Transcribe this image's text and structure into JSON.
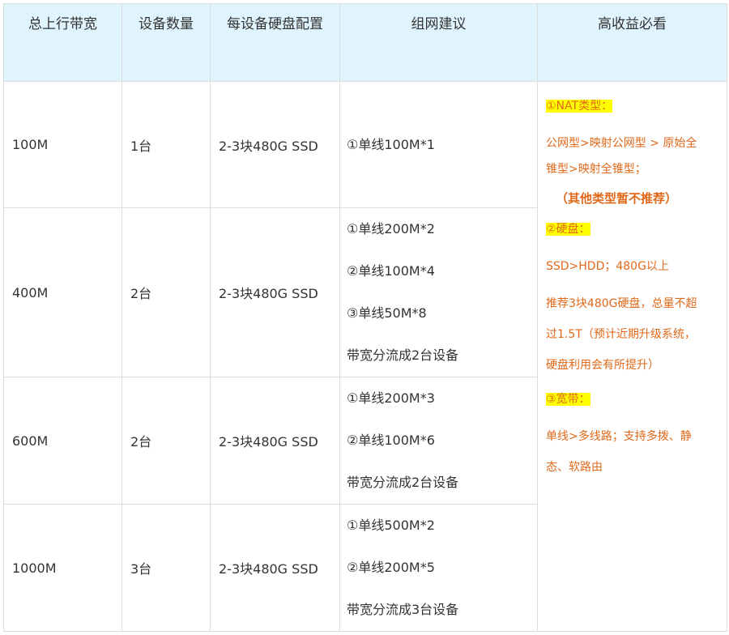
{
  "headers": [
    "总上行带宽",
    "设备数量",
    "每设备硬盘配置",
    "组网建议",
    "高收益必看"
  ],
  "rows": [
    {
      "bandwidth": "100M",
      "devices": "1台",
      "disk": "2-3块480G  SSD",
      "advice": [
        "①单线100M*1"
      ]
    },
    {
      "bandwidth": "400M",
      "devices": "2台",
      "disk": "2-3块480G  SSD",
      "advice": [
        "①单线200M*2",
        "②单线100M*4",
        "③单线50M*8",
        "带宽分流成2台设备"
      ]
    },
    {
      "bandwidth": "600M",
      "devices": "2台",
      "disk": "2-3块480G  SSD",
      "advice": [
        "①单线200M*3",
        "②单线100M*6",
        "带宽分流成2台设备"
      ]
    },
    {
      "bandwidth": "1000M",
      "devices": "3台",
      "disk": "2-3块480G  SSD",
      "advice": [
        "①单线500M*2",
        "②单线200M*5",
        "带宽分流成3台设备"
      ]
    }
  ],
  "notes": {
    "nat_title": "①NAT类型：",
    "nat_line1": "公网型>映射公网型 > 原始全",
    "nat_line2": "锥型>映射全锥型；",
    "nat_bold": "（其他类型暂不推荐）",
    "disk_title": "②硬盘：",
    "disk_line1": "SSD>HDD；480G以上",
    "disk_line2": "推荐3块480G硬盘，总量不超",
    "disk_line3": "过1.5T（预计近期升级系统，",
    "disk_line4": "硬盘利用会有所提升）",
    "bw_title": "③宽带：",
    "bw_line1": "单线>多线路；支持多拨、静",
    "bw_line2": "态、软路由"
  },
  "colors": {
    "header_bg": "#dff4fd",
    "note_text": "#e0691a",
    "highlight": "#ffff00"
  }
}
